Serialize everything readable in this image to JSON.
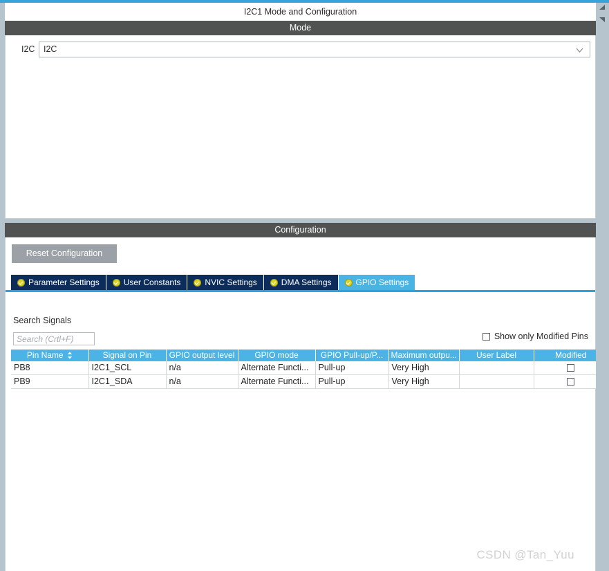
{
  "window": {
    "title": "I2C1 Mode and Configuration"
  },
  "mode_section": {
    "header": "Mode",
    "peripheral_label": "I2C",
    "peripheral_value": "I2C",
    "dropdown_icon": "chevron-down-icon"
  },
  "configuration_section": {
    "header": "Configuration",
    "reset_button": "Reset Configuration",
    "tabs": [
      {
        "label": "Parameter Settings",
        "icon": "check-circle-icon",
        "active": false
      },
      {
        "label": "User Constants",
        "icon": "check-circle-icon",
        "active": false
      },
      {
        "label": "NVIC Settings",
        "icon": "check-circle-icon",
        "active": false
      },
      {
        "label": "DMA Settings",
        "icon": "check-circle-icon",
        "active": false
      },
      {
        "label": "GPIO Settings",
        "icon": "check-circle-icon",
        "active": true
      }
    ]
  },
  "gpio_panel": {
    "search_label": "Search Signals",
    "search_value": "",
    "search_placeholder": "Search (Crtl+F)",
    "show_modified_label": "Show only Modified Pins",
    "show_modified_checked": false,
    "columns": [
      "Pin Name",
      "Signal on Pin",
      "GPIO output level",
      "GPIO mode",
      "GPIO Pull-up/P...",
      "Maximum outpu...",
      "User Label",
      "Modified"
    ],
    "sorted_column": "Pin Name",
    "rows": [
      {
        "pin_name": "PB8",
        "signal_on_pin": "I2C1_SCL",
        "gpio_output_level": "n/a",
        "gpio_mode": "Alternate Functi...",
        "gpio_pull": "Pull-up",
        "max_output_speed": "Very High",
        "user_label": "",
        "modified": false
      },
      {
        "pin_name": "PB9",
        "signal_on_pin": "I2C1_SDA",
        "gpio_output_level": "n/a",
        "gpio_mode": "Alternate Functi...",
        "gpio_pull": "Pull-up",
        "max_output_speed": "Very High",
        "user_label": "",
        "modified": false
      }
    ]
  },
  "watermark": {
    "text": "CSDN @Tan_Yuu"
  },
  "colors": {
    "accent_cyan": "#36a3d9",
    "tab_active": "#49b4e3",
    "tab_inactive": "#0c2d5c",
    "section_bar": "#515353",
    "table_header": "#4bb4e4",
    "panel_bg": "#b6c4cd",
    "button_disabled": "#9ba1a6"
  }
}
